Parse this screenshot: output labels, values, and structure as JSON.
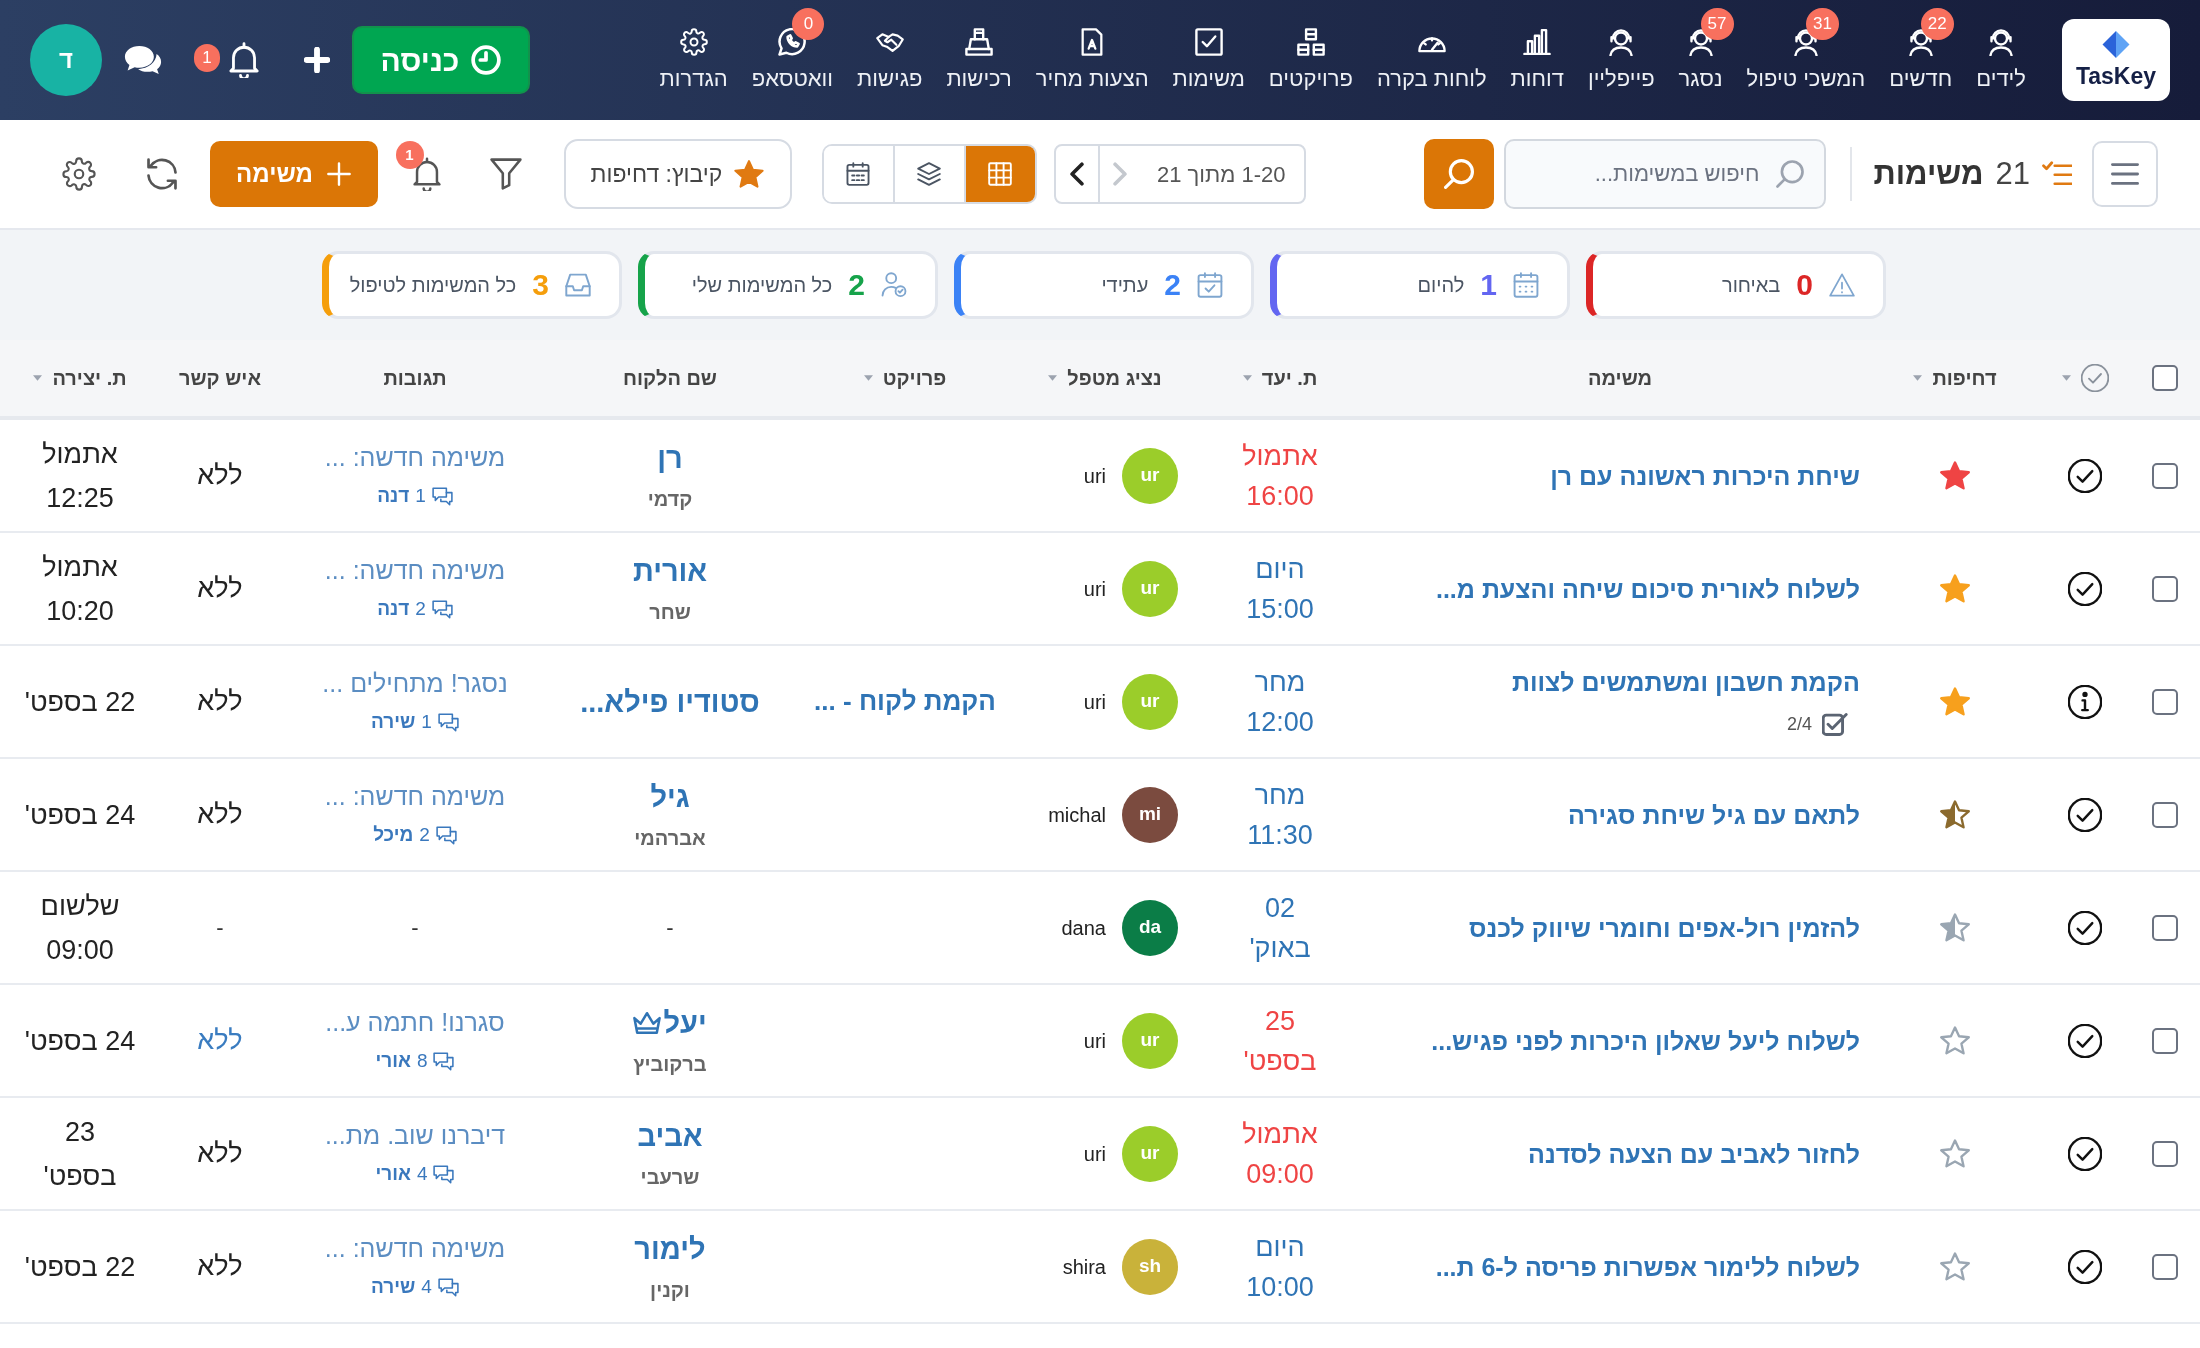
{
  "top_nav": {
    "logo": "TasKey",
    "items": [
      {
        "label": "לידים",
        "kind": "person"
      },
      {
        "label": "חדשים",
        "kind": "person",
        "badge": "22"
      },
      {
        "label": "המשכי טיפול",
        "kind": "person",
        "badge": "31"
      },
      {
        "label": "נסגר",
        "kind": "person",
        "badge": "57"
      },
      {
        "label": "פייפליין",
        "kind": "person"
      },
      {
        "label": "דוחות",
        "kind": "chart"
      },
      {
        "label": "לוחות בקרה",
        "kind": "gauge"
      },
      {
        "label": "פרויקטים",
        "kind": "cubes"
      },
      {
        "label": "משימות",
        "kind": "task"
      },
      {
        "label": "הצעות מחיר",
        "kind": "document"
      },
      {
        "label": "רכישות",
        "kind": "register"
      },
      {
        "label": "פגישות",
        "kind": "handshake"
      },
      {
        "label": "וואטסאפ",
        "kind": "whatsapp",
        "badge": "0"
      },
      {
        "label": "הגדרות",
        "kind": "settings"
      }
    ],
    "checkin_button": "כניסה",
    "notifications_badge": "1",
    "avatar": "ד"
  },
  "toolbar": {
    "count": "21",
    "title": "משימות",
    "search": {
      "placeholder": "חיפוש במשימות..."
    },
    "pagination": {
      "text": "1-20 מתוך 21",
      "prev_disabled": true,
      "next_disabled": false
    },
    "views": [
      {
        "kind": "grid",
        "selected": true
      },
      {
        "kind": "layers",
        "selected": false
      },
      {
        "kind": "calendar",
        "selected": false
      }
    ],
    "group_by": "קיבוץ: דחיפות",
    "notifications_badge": "1",
    "add_button": "משימה"
  },
  "filter_cards": [
    {
      "label": "באיחור",
      "count": "0",
      "kind": "warning",
      "color": "#dc2626"
    },
    {
      "label": "להיום",
      "count": "1",
      "kind": "today",
      "color": "#6366f1"
    },
    {
      "label": "עתידי",
      "count": "2",
      "kind": "future",
      "color": "#3b82f6"
    },
    {
      "label": "כל המשימות שלי",
      "count": "2",
      "kind": "mine",
      "color": "#16a34a"
    },
    {
      "label": "כל המשימות לטיפול",
      "count": "3",
      "kind": "inbox",
      "color": "#f59e0b"
    }
  ],
  "table": {
    "columns": [
      {
        "kind": "checkbox",
        "checked": false
      },
      {
        "kind": "status",
        "sortable": true
      },
      {
        "kind": "text",
        "label": "דחיפות",
        "sortable": true
      },
      {
        "kind": "text",
        "label": "משימה",
        "sortable": false
      },
      {
        "kind": "text",
        "label": "ת. יעד",
        "sortable": true
      },
      {
        "kind": "text",
        "label": "נציג מטפל",
        "sortable": true
      },
      {
        "kind": "text",
        "label": "פרויקט",
        "sortable": true
      },
      {
        "kind": "text",
        "label": "שם הלקוח",
        "sortable": false
      },
      {
        "kind": "text",
        "label": "תגובות",
        "sortable": false
      },
      {
        "kind": "text",
        "label": "איש קשר",
        "sortable": false
      },
      {
        "kind": "text",
        "label": "ת. יצירה",
        "sortable": true
      }
    ],
    "rows": [
      {
        "checked": false,
        "status": {
          "kind": "check"
        },
        "priority": {
          "kind": "full",
          "color": "#ef4444"
        },
        "title": "שיחת היכרות ראשונה עם רן",
        "due": {
          "lines": [
            "אתמול",
            "16:00"
          ],
          "overdue": true
        },
        "rep": {
          "initials": "ur",
          "name": "uri",
          "color": "#9bcd2a"
        },
        "client": {
          "name": "רן",
          "surname": "קדמי",
          "vip": false
        },
        "comments": {
          "preview": "משימה חדשה: ...",
          "count": "1",
          "author": "דנה"
        },
        "contact": {
          "text": "ללא",
          "link": false
        },
        "created": [
          "אתמול",
          "12:25"
        ]
      },
      {
        "checked": false,
        "status": {
          "kind": "check"
        },
        "priority": {
          "kind": "full",
          "color": "#f7a01d"
        },
        "title": "לשלוח לאורית סיכום שיחה והצעת מ...",
        "due": {
          "lines": [
            "היום",
            "15:00"
          ],
          "overdue": false
        },
        "rep": {
          "initials": "ur",
          "name": "uri",
          "color": "#9bcd2a"
        },
        "client": {
          "name": "אורית",
          "surname": "שחר",
          "vip": false
        },
        "comments": {
          "preview": "משימה חדשה: ...",
          "count": "2",
          "author": "דנה"
        },
        "contact": {
          "text": "ללא",
          "link": false
        },
        "created": [
          "אתמול",
          "10:20"
        ]
      },
      {
        "checked": false,
        "status": {
          "kind": "info"
        },
        "priority": {
          "kind": "full",
          "color": "#f7a01d"
        },
        "title": "הקמת חשבון ומשתמשים לצוות",
        "subtasks": "2/4",
        "due": {
          "lines": [
            "מחר",
            "12:00"
          ],
          "overdue": false
        },
        "rep": {
          "initials": "ur",
          "name": "uri",
          "color": "#9bcd2a"
        },
        "project": "הקמת לקוח - ...",
        "client": {
          "name": "סטודיו פילא...",
          "vip": false
        },
        "comments": {
          "preview": "נסגר! מתחילים ...",
          "count": "1",
          "author": "שירה"
        },
        "contact": {
          "text": "ללא",
          "link": false
        },
        "created": [
          "22 בספט'"
        ]
      },
      {
        "checked": false,
        "status": {
          "kind": "check"
        },
        "priority": {
          "kind": "half",
          "color": "#8b6a2e"
        },
        "title": "לתאם עם גיל שיחת סגירה",
        "due": {
          "lines": [
            "מחר",
            "11:30"
          ],
          "overdue": false
        },
        "rep": {
          "initials": "mi",
          "name": "michal",
          "color": "#7b4b3f"
        },
        "client": {
          "name": "גיל",
          "surname": "אברהמי",
          "vip": false
        },
        "comments": {
          "preview": "משימה חדשה: ...",
          "count": "2",
          "author": "מיכל"
        },
        "contact": {
          "text": "ללא",
          "link": false
        },
        "created": [
          "24 בספט'"
        ]
      },
      {
        "checked": false,
        "status": {
          "kind": "check"
        },
        "priority": {
          "kind": "half",
          "color": "#9aa6b2"
        },
        "title": "להזמין רול-אפים וחומרי שיווק לכנס",
        "due": {
          "lines": [
            "02",
            "באוק'"
          ],
          "overdue": false
        },
        "rep": {
          "initials": "da",
          "name": "dana",
          "color": "#0b7d47"
        },
        "client": "-",
        "comments": "-",
        "contact": "-",
        "created": [
          "שלשום",
          "09:00"
        ]
      },
      {
        "checked": false,
        "status": {
          "kind": "check"
        },
        "priority": {
          "kind": "outline",
          "color": "#9aa6b2"
        },
        "title": "לשלוח ליעל שאלון היכרות לפני פגיש...",
        "due": {
          "lines": [
            "25",
            "בספט'"
          ],
          "overdue": true
        },
        "rep": {
          "initials": "ur",
          "name": "uri",
          "color": "#9bcd2a"
        },
        "client": {
          "name": "יעל",
          "surname": "ברקוביץ",
          "vip": true
        },
        "comments": {
          "preview": "סגרנו! חתמה ע...",
          "count": "8",
          "author": "אורי"
        },
        "contact": {
          "text": "ללא",
          "link": true
        },
        "created": [
          "24 בספט'"
        ]
      },
      {
        "checked": false,
        "status": {
          "kind": "check"
        },
        "priority": {
          "kind": "outline",
          "color": "#9aa6b2"
        },
        "title": "לחזור לאביב עם הצעה לסדנה",
        "due": {
          "lines": [
            "אתמול",
            "09:00"
          ],
          "overdue": true
        },
        "rep": {
          "initials": "ur",
          "name": "uri",
          "color": "#9bcd2a"
        },
        "client": {
          "name": "אביב",
          "surname": "שרעבי",
          "vip": false
        },
        "comments": {
          "preview": "דיברנו שוב. מת...",
          "count": "4",
          "author": "אורי"
        },
        "contact": {
          "text": "ללא",
          "link": false
        },
        "created": [
          "23",
          "בספט'"
        ]
      },
      {
        "checked": false,
        "status": {
          "kind": "check"
        },
        "priority": {
          "kind": "outline",
          "color": "#9aa6b2"
        },
        "title": "לשלוח ללימור אפשרות פריסה ל-6 ת...",
        "due": {
          "lines": [
            "היום",
            "10:00"
          ],
          "overdue": false
        },
        "rep": {
          "initials": "sh",
          "name": "shira",
          "color": "#c9b23a"
        },
        "client": {
          "name": "לימור",
          "surname": "וקנין",
          "vip": false
        },
        "comments": {
          "preview": "משימה חדשה: ...",
          "count": "4",
          "author": "שירה"
        },
        "contact": {
          "text": "ללא",
          "link": false
        },
        "created": [
          "22 בספט'"
        ]
      }
    ]
  }
}
